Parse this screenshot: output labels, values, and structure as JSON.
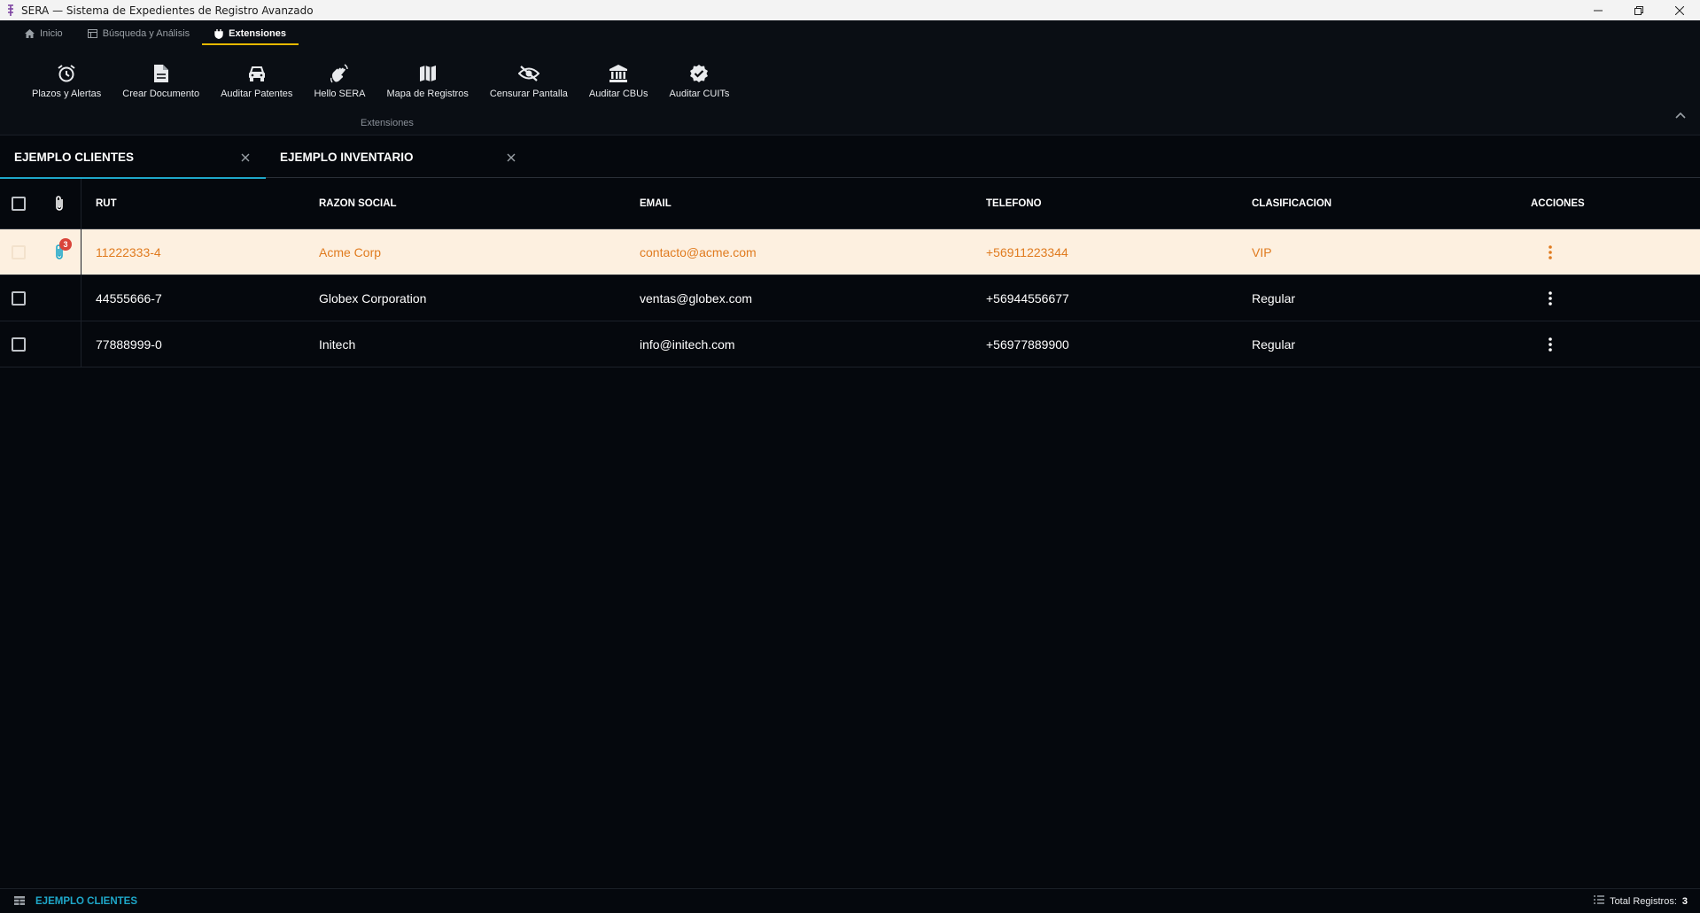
{
  "window": {
    "title": "SERA — Sistema de Expedientes de Registro Avanzado"
  },
  "ribbon_tabs": [
    {
      "label": "Inicio",
      "icon": "home-icon",
      "active": false
    },
    {
      "label": "Búsqueda y Análisis",
      "icon": "table-icon",
      "active": false
    },
    {
      "label": "Extensiones",
      "icon": "plug-icon",
      "active": true
    }
  ],
  "ribbon": {
    "buttons": [
      {
        "label": "Plazos y Alertas",
        "icon": "alarm-clock-icon"
      },
      {
        "label": "Crear Documento",
        "icon": "document-icon"
      },
      {
        "label": "Auditar Patentes",
        "icon": "car-icon"
      },
      {
        "label": "Hello SERA",
        "icon": "waving-hand-icon"
      },
      {
        "label": "Mapa de Registros",
        "icon": "map-icon"
      },
      {
        "label": "Censurar Pantalla",
        "icon": "eye-slash-icon"
      },
      {
        "label": "Auditar CBUs",
        "icon": "bank-icon"
      },
      {
        "label": "Auditar CUITs",
        "icon": "verified-badge-icon"
      }
    ],
    "group_label": "Extensiones"
  },
  "doc_tabs": [
    {
      "label": "EJEMPLO CLIENTES",
      "active": true
    },
    {
      "label": "EJEMPLO INVENTARIO",
      "active": false
    }
  ],
  "grid": {
    "columns": [
      "RUT",
      "RAZON SOCIAL",
      "EMAIL",
      "TELEFONO",
      "CLASIFICACION",
      "ACCIONES"
    ],
    "rows": [
      {
        "rut": "11222333-4",
        "razon": "Acme Corp",
        "email": "contacto@acme.com",
        "telefono": "+56911223344",
        "clasificacion": "VIP",
        "attachments": "3",
        "selected": true
      },
      {
        "rut": "44555666-7",
        "razon": "Globex Corporation",
        "email": "ventas@globex.com",
        "telefono": "+56944556677",
        "clasificacion": "Regular",
        "attachments": "",
        "selected": false
      },
      {
        "rut": "77888999-0",
        "razon": "Initech",
        "email": "info@initech.com",
        "telefono": "+56977889900",
        "clasificacion": "Regular",
        "attachments": "",
        "selected": false
      }
    ]
  },
  "status": {
    "table_name": "EJEMPLO CLIENTES",
    "total_label": "Total Registros:",
    "total_value": "3"
  },
  "colors": {
    "accent": "#1ea7c9",
    "selected_row_bg": "#fdf0e0",
    "selected_row_text": "#e07b1f",
    "active_tab_underline": "#e6b800",
    "badge": "#d9443a"
  }
}
